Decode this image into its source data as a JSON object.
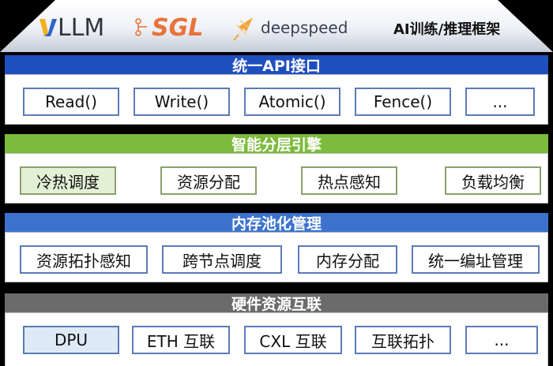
{
  "banner": {
    "vllm_label": "LLM",
    "sgl_label": "SGL",
    "deepspeed_label": "deepspeed",
    "title": "AI训练/推理框架"
  },
  "layers": [
    {
      "title": "统一API接口",
      "bar_color": "#1f4fbf",
      "items": [
        "Read()",
        "Write()",
        "Atomic()",
        "Fence()",
        "..."
      ]
    },
    {
      "title": "智能分层引擎",
      "bar_color": "#7dbb3c",
      "items": [
        "冷热调度",
        "资源分配",
        "热点感知",
        "负载均衡"
      ]
    },
    {
      "title": "内存池化管理",
      "bar_color": "#3d73cf",
      "items": [
        "资源拓扑感知",
        "跨节点调度",
        "内存分配",
        "统一编址管理"
      ]
    },
    {
      "title": "硬件资源互联",
      "bar_color": "#6b6b6b",
      "items": [
        "DPU",
        "ETH 互联",
        "CXL 互联",
        "互联拓扑",
        "..."
      ]
    }
  ]
}
